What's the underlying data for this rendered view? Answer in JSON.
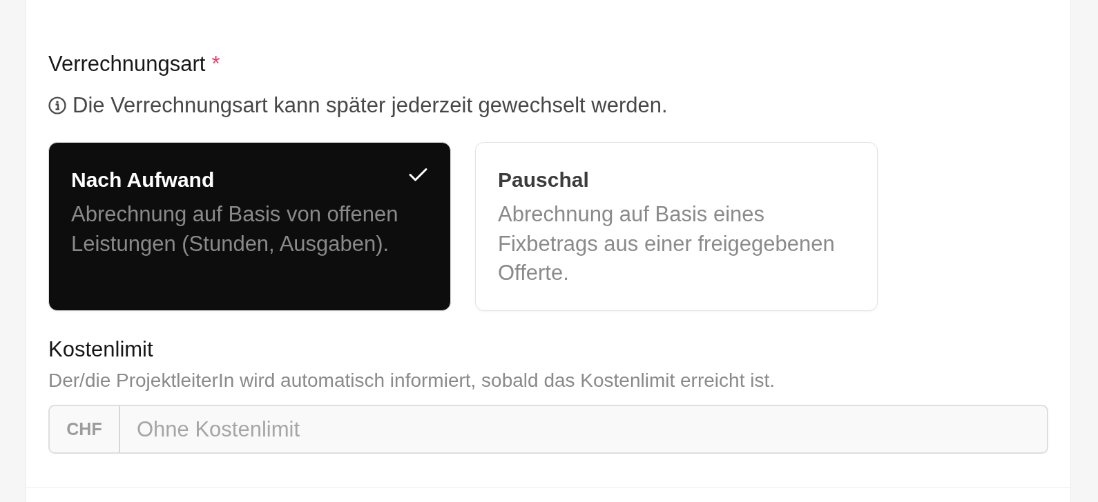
{
  "billing_type": {
    "label": "Verrechnungsart",
    "required_mark": "*",
    "hint": "Die Verrechnungsart kann später jederzeit gewechselt werden.",
    "options": [
      {
        "title": "Nach Aufwand",
        "description": "Abrechnung auf Basis von offenen Leistungen (Stunden, Ausgaben).",
        "selected": true
      },
      {
        "title": "Pauschal",
        "description": "Abrechnung auf Basis eines Fixbetrags aus einer freigegebenen Offerte.",
        "selected": false
      }
    ]
  },
  "cost_limit": {
    "label": "Kostenlimit",
    "help": "Der/die ProjektleiterIn wird automatisch informiert, sobald das Kostenlimit erreicht ist.",
    "currency": "CHF",
    "placeholder": "Ohne Kostenlimit"
  }
}
